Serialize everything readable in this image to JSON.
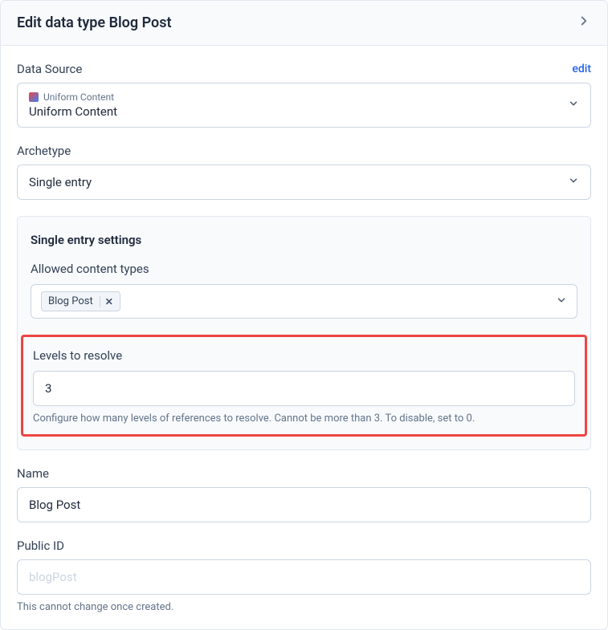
{
  "header": {
    "title": "Edit data type Blog Post"
  },
  "dataSource": {
    "label": "Data Source",
    "editLink": "edit",
    "providerLabel": "Uniform Content",
    "value": "Uniform Content"
  },
  "archetype": {
    "label": "Archetype",
    "value": "Single entry"
  },
  "settings": {
    "title": "Single entry settings",
    "allowedTypes": {
      "label": "Allowed content types",
      "tag": "Blog Post"
    },
    "levels": {
      "label": "Levels to resolve",
      "value": "3",
      "help": "Configure how many levels of references to resolve. Cannot be more than 3. To disable, set to 0."
    }
  },
  "name": {
    "label": "Name",
    "value": "Blog Post"
  },
  "publicId": {
    "label": "Public ID",
    "placeholder": "blogPost",
    "help": "This cannot change once created."
  }
}
